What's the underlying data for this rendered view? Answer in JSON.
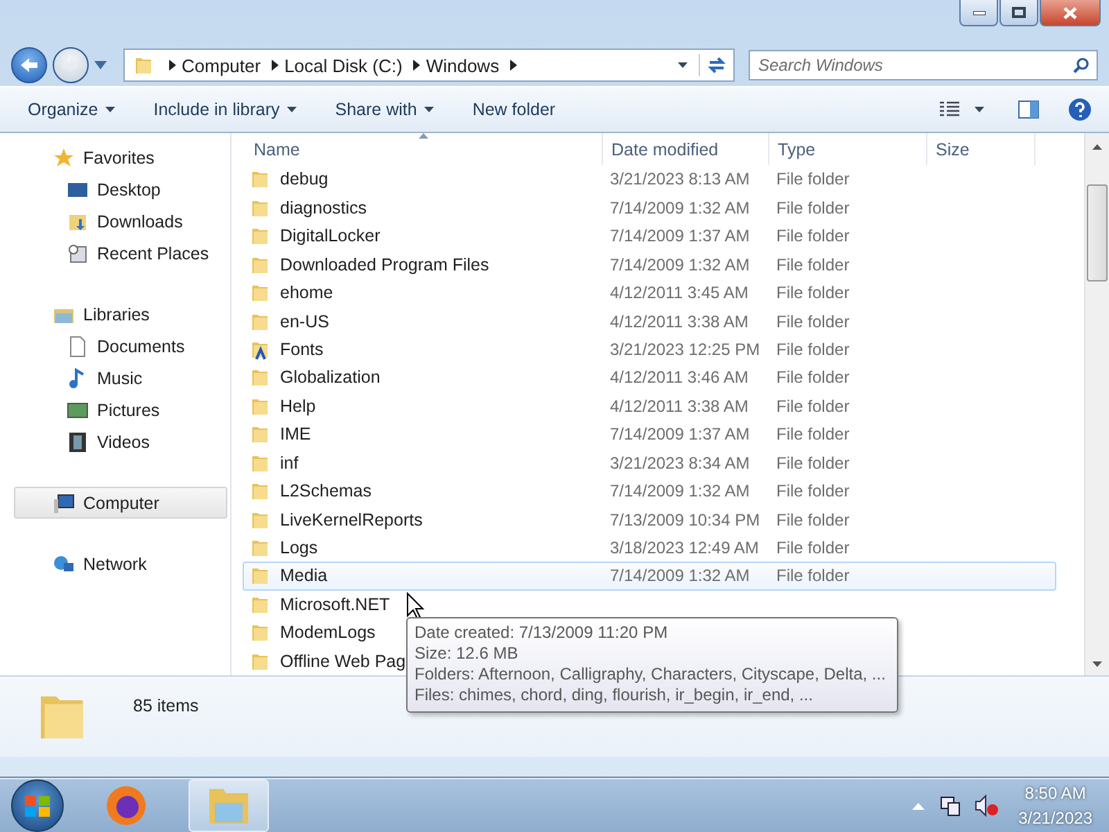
{
  "address_bar": {
    "breadcrumbs": [
      "Computer",
      "Local Disk (C:)",
      "Windows"
    ]
  },
  "search": {
    "placeholder": "Search Windows"
  },
  "toolbar": {
    "items": [
      {
        "label": "Organize",
        "dropdown": true
      },
      {
        "label": "Include in library",
        "dropdown": true
      },
      {
        "label": "Share with",
        "dropdown": true
      },
      {
        "label": "New folder",
        "dropdown": false
      }
    ]
  },
  "navigation": {
    "groups": [
      {
        "label": "Favorites",
        "kind": "star",
        "selected": false,
        "children": [
          {
            "label": "Desktop",
            "kind": "desktop",
            "selected": false
          },
          {
            "label": "Downloads",
            "kind": "downloads",
            "selected": false
          },
          {
            "label": "Recent Places",
            "kind": "recent",
            "selected": false
          }
        ]
      },
      {
        "label": "Libraries",
        "kind": "library",
        "selected": false,
        "children": [
          {
            "label": "Documents",
            "kind": "document",
            "selected": false
          },
          {
            "label": "Music",
            "kind": "music",
            "selected": false
          },
          {
            "label": "Pictures",
            "kind": "picture",
            "selected": false
          },
          {
            "label": "Videos",
            "kind": "video",
            "selected": false
          }
        ]
      },
      {
        "label": "Computer",
        "kind": "computer",
        "selected": true
      },
      {
        "label": "Network",
        "kind": "network",
        "selected": false
      }
    ]
  },
  "file_list": {
    "columns": [
      "Name",
      "Date modified",
      "Type",
      "Size"
    ],
    "rows": [
      {
        "name": "debug",
        "date": "3/21/2023 8:13 AM",
        "type": "File folder",
        "kind": "folder",
        "hovered": false
      },
      {
        "name": "diagnostics",
        "date": "7/14/2009 1:32 AM",
        "type": "File folder",
        "kind": "folder",
        "hovered": false
      },
      {
        "name": "DigitalLocker",
        "date": "7/14/2009 1:37 AM",
        "type": "File folder",
        "kind": "folder",
        "hovered": false
      },
      {
        "name": "Downloaded Program Files",
        "date": "7/14/2009 1:32 AM",
        "type": "File folder",
        "kind": "folder",
        "hovered": false
      },
      {
        "name": "ehome",
        "date": "4/12/2011 3:45 AM",
        "type": "File folder",
        "kind": "folder",
        "hovered": false
      },
      {
        "name": "en-US",
        "date": "4/12/2011 3:38 AM",
        "type": "File folder",
        "kind": "folder",
        "hovered": false
      },
      {
        "name": "Fonts",
        "date": "3/21/2023 12:25 PM",
        "type": "File folder",
        "kind": "fonts",
        "hovered": false
      },
      {
        "name": "Globalization",
        "date": "4/12/2011 3:46 AM",
        "type": "File folder",
        "kind": "folder",
        "hovered": false
      },
      {
        "name": "Help",
        "date": "4/12/2011 3:38 AM",
        "type": "File folder",
        "kind": "folder",
        "hovered": false
      },
      {
        "name": "IME",
        "date": "7/14/2009 1:37 AM",
        "type": "File folder",
        "kind": "folder",
        "hovered": false
      },
      {
        "name": "inf",
        "date": "3/21/2023 8:34 AM",
        "type": "File folder",
        "kind": "folder",
        "hovered": false
      },
      {
        "name": "L2Schemas",
        "date": "7/14/2009 1:32 AM",
        "type": "File folder",
        "kind": "folder",
        "hovered": false
      },
      {
        "name": "LiveKernelReports",
        "date": "7/13/2009 10:34 PM",
        "type": "File folder",
        "kind": "folder",
        "hovered": false
      },
      {
        "name": "Logs",
        "date": "3/18/2023 12:49 AM",
        "type": "File folder",
        "kind": "folder",
        "hovered": false
      },
      {
        "name": "Media",
        "date": "7/14/2009 1:32 AM",
        "type": "File folder",
        "kind": "folder",
        "hovered": true
      },
      {
        "name": "Microsoft.NET",
        "kind": "folder",
        "hovered": false
      },
      {
        "name": "ModemLogs",
        "kind": "folder",
        "hovered": false
      },
      {
        "name": "Offline Web Pag",
        "kind": "folder",
        "hovered": false
      }
    ]
  },
  "tooltip": {
    "lines": [
      "Date created: 7/13/2009 11:20 PM",
      "Size: 12.6 MB",
      "Folders: Afternoon, Calligraphy, Characters, Cityscape, Delta, ...",
      "Files: chimes, chord, ding, flourish, ir_begin, ir_end, ..."
    ]
  },
  "details_pane": {
    "count": "85 items"
  },
  "taskbar": {
    "apps": [
      {
        "kind": "firefox",
        "active": false
      },
      {
        "kind": "explorer",
        "active": true
      }
    ],
    "time": "8:50 AM",
    "date": "3/21/2023"
  }
}
